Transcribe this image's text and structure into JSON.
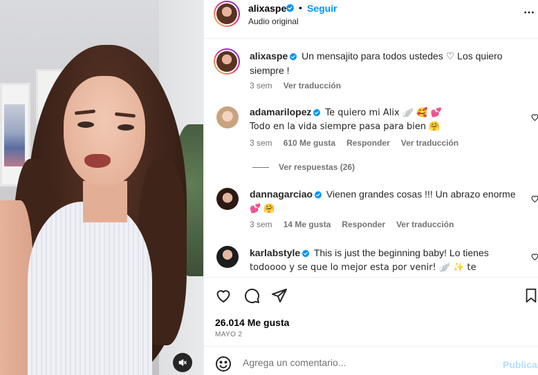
{
  "post": {
    "username": "alixaspe",
    "follow_label": "Seguir",
    "audio": "Audio original",
    "more_icon": "more-horizontal-icon"
  },
  "caption": {
    "username": "alixaspe",
    "text": "Un mensajito para todos ustedes ♡  Los quiero siempre !",
    "time": "3 sem",
    "translate": "Ver traducción"
  },
  "comments": [
    {
      "username": "adamarilopez",
      "text": "Te quiero mi Alix 🪽 🥰 💕",
      "text2": "Todo en la vida siempre pasa para bien 🤗",
      "time": "3 sem",
      "likes": "610 Me gusta",
      "reply": "Responder",
      "translate": "Ver traducción",
      "view_replies": "Ver respuestas (26)"
    },
    {
      "username": "dannagarciao",
      "text": "Vienen grandes cosas !!! Un abrazo enorme",
      "text2": "💕 🤗",
      "time": "3 sem",
      "likes": "14 Me gusta",
      "reply": "Responder",
      "translate": "Ver traducción"
    },
    {
      "username": "karlabstyle",
      "text": "This is just the beginning baby! Lo tienes",
      "text2": "todoooo y se que lo mejor esta por venir! 🪽 ✨ te"
    }
  ],
  "actions": {
    "likes": "26.014 Me gusta",
    "date": "MAYO 2"
  },
  "add_comment": {
    "placeholder": "Agrega un comentario...",
    "publish": "Publicar"
  },
  "colors": {
    "accent": "#0095f6",
    "verified": "#0095f6",
    "publish_disabled": "#b2dffc",
    "muted": "#737373"
  }
}
